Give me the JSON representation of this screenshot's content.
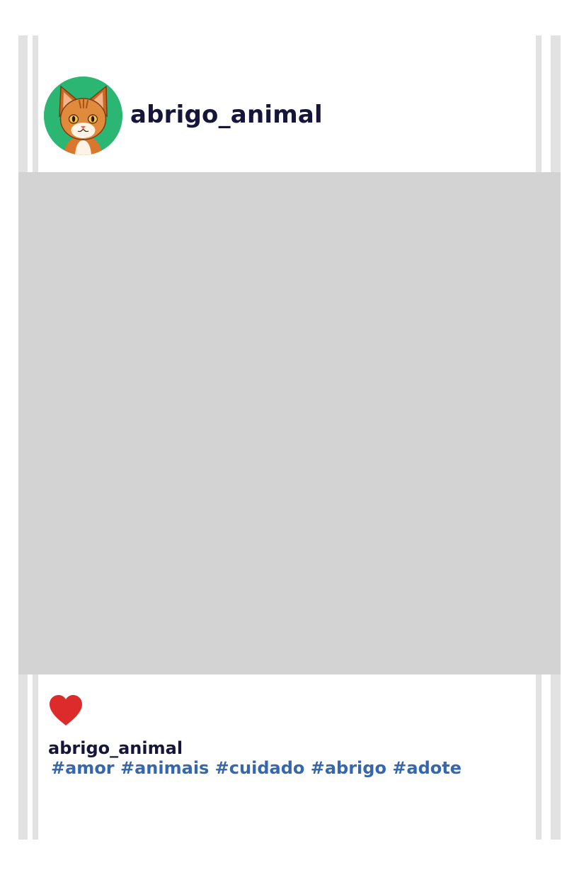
{
  "post": {
    "username": "abrigo_animal",
    "caption_username": "abrigo_animal",
    "hashtags": "#amor #animais #cuidado #abrigo #adote",
    "liked": true
  },
  "colors": {
    "avatar_background": "#2bb673",
    "username": "#16163a",
    "hashtags": "#3567b0",
    "like": "#dd2b2b",
    "media_placeholder": "#d3d3d3"
  },
  "icons": {
    "avatar": "cat-avatar-icon",
    "like": "heart-icon"
  }
}
